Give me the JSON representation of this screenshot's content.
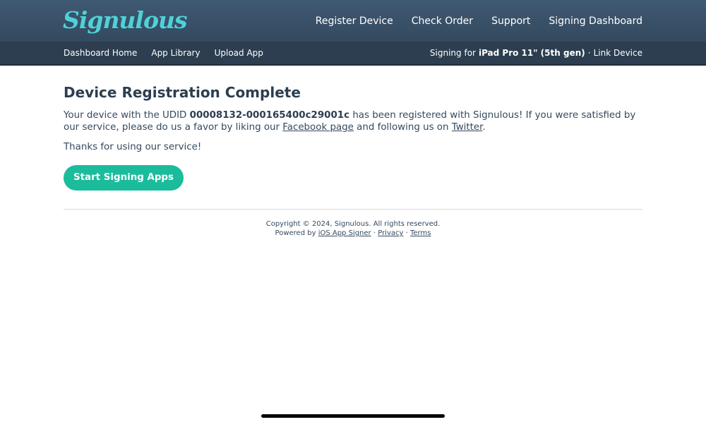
{
  "header": {
    "logo_text": "Signulous",
    "nav": [
      "Register Device",
      "Check Order",
      "Support",
      "Signing Dashboard"
    ]
  },
  "subnav": {
    "left": [
      "Dashboard Home",
      "App Library",
      "Upload App"
    ],
    "signing_prefix": "Signing for",
    "device_name": "iPad Pro 11\" (5th gen)",
    "separator": "·",
    "link_device": "Link Device"
  },
  "main": {
    "title": "Device Registration Complete",
    "msg_part1": "Your device with the UDID",
    "udid": "00008132-000165400c29001c",
    "msg_part2": "has been registered with Signulous! If you were satisfied by our service, please do us a favor by liking our",
    "facebook_link": "Facebook page",
    "msg_part3": "and following us on",
    "twitter_link": "Twitter",
    "msg_part4": ".",
    "thanks": "Thanks for using our service!",
    "cta_label": "Start Signing Apps"
  },
  "footer": {
    "copyright": "Copyright © 2024, Signulous. All rights reserved.",
    "powered_by": "Powered by",
    "signer_link": "iOS App Signer",
    "sep": "·",
    "privacy_link": "Privacy",
    "terms_link": "Terms"
  },
  "colors": {
    "header_bg": "#34495e",
    "subbar_bg": "#2c3e50",
    "accent": "#1abc9c",
    "logo": "#4fd1d9"
  }
}
